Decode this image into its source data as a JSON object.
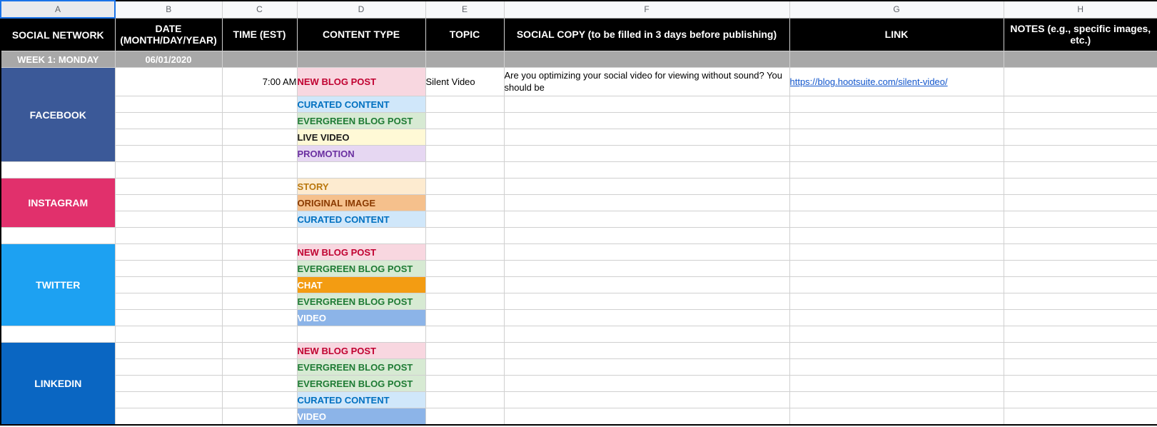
{
  "cols": [
    "A",
    "B",
    "C",
    "D",
    "E",
    "F",
    "G",
    "H"
  ],
  "headers": {
    "A": "SOCIAL NETWORK",
    "B": "DATE (MONTH/DAY/YEAR)",
    "C": "TIME (EST)",
    "D": "CONTENT TYPE",
    "E": "TOPIC",
    "F": "SOCIAL COPY (to be filled in 3 days before publishing)",
    "G": "LINK",
    "H": "NOTES (e.g., specific images, etc.)"
  },
  "week": {
    "label": "WEEK 1: MONDAY",
    "date": "06/01/2020"
  },
  "networks": {
    "facebook": "FACEBOOK",
    "instagram": "INSTAGRAM",
    "twitter": "TWITTER",
    "linkedin": "LINKEDIN"
  },
  "row_fb1": {
    "time": "7:00 AM",
    "ctype": "NEW BLOG POST",
    "topic": "Silent Video",
    "copy": "Are you optimizing your social video for viewing without sound? You should be",
    "link": "https://blog.hootsuite.com/silent-video/"
  },
  "ctypes": {
    "curated": "CURATED CONTENT",
    "evergreen": "EVERGREEN BLOG POST",
    "live": "LIVE VIDEO",
    "promo": "PROMOTION",
    "story": "STORY",
    "origimg": "ORIGINAL IMAGE",
    "newblog": "NEW BLOG POST",
    "chat": "CHAT",
    "video": "VIDEO"
  }
}
